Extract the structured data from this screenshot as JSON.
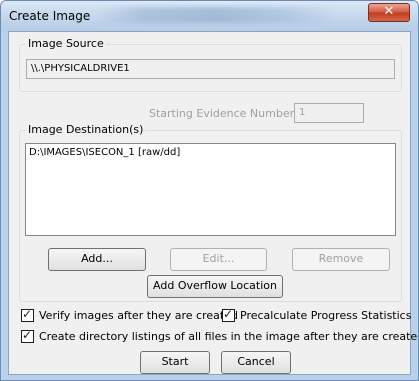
{
  "window": {
    "title": "Create Image",
    "close_glyph": "✕"
  },
  "image_source": {
    "group_label": "Image Source",
    "value": "\\\\.\\PHYSICALDRIVE1"
  },
  "evidence": {
    "label": "Starting Evidence Number:",
    "value": "1"
  },
  "image_destination": {
    "group_label": "Image Destination(s)",
    "items": [
      "D:\\IMAGES\\ISECON_1 [raw/dd]"
    ],
    "add_label": "Add...",
    "edit_label": "Edit...",
    "remove_label": "Remove",
    "overflow_label": "Add Overflow Location"
  },
  "options": {
    "verify_label": "Verify images after they are created",
    "verify_checked": true,
    "precalc_label": "Precalculate Progress Statistics",
    "precalc_checked": true,
    "dirlist_label": "Create directory listings of all files in the image after they are created",
    "dirlist_checked": true
  },
  "actions": {
    "start_label": "Start",
    "cancel_label": "Cancel"
  }
}
